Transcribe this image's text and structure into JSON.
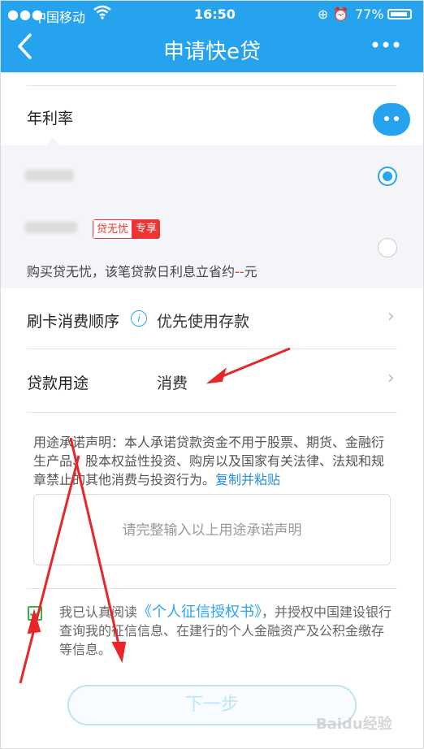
{
  "status_bar": {
    "carrier": "中国移动",
    "time": "16:50",
    "battery": "77%"
  },
  "nav": {
    "title": "申请快e贷"
  },
  "interest": {
    "label": "年利率",
    "option2_badge_a": "贷无忧",
    "option2_badge_b": "专享",
    "option2_note": "购买贷无忧，该笔贷款日利息立省约",
    "option2_note_value": "--",
    "option2_note_unit": "元",
    "selected_option": 1
  },
  "card_order": {
    "label": "刷卡消费顺序",
    "value": "优先使用存款"
  },
  "purpose": {
    "label": "贷款用途",
    "value": "消费"
  },
  "declaration": {
    "text": "用途承诺声明：本人承诺贷款资金不用于股票、期货、金融衍生产品、股本权益性投资、购房以及国家有关法律、法规和规章禁止的其他消费与投资行为。",
    "link": "复制并粘贴"
  },
  "declaration_input": {
    "placeholder": "请完整输入以上用途承诺声明"
  },
  "agreement": {
    "checked": true,
    "prefix": "我已认真阅读",
    "link": "《个人征信授权书》",
    "suffix": "，并授权中国建设银行查询我的征信信息、在建行的个人金融资产及公积金缴存等信息。"
  },
  "next_button": {
    "label": "下一步"
  },
  "watermark": {
    "text": "Baidu经验"
  },
  "colors": {
    "brand": "#26a3ee",
    "badge_red": "#e33333",
    "check_green": "#3bb04a",
    "annotation_red": "#e8262a"
  }
}
